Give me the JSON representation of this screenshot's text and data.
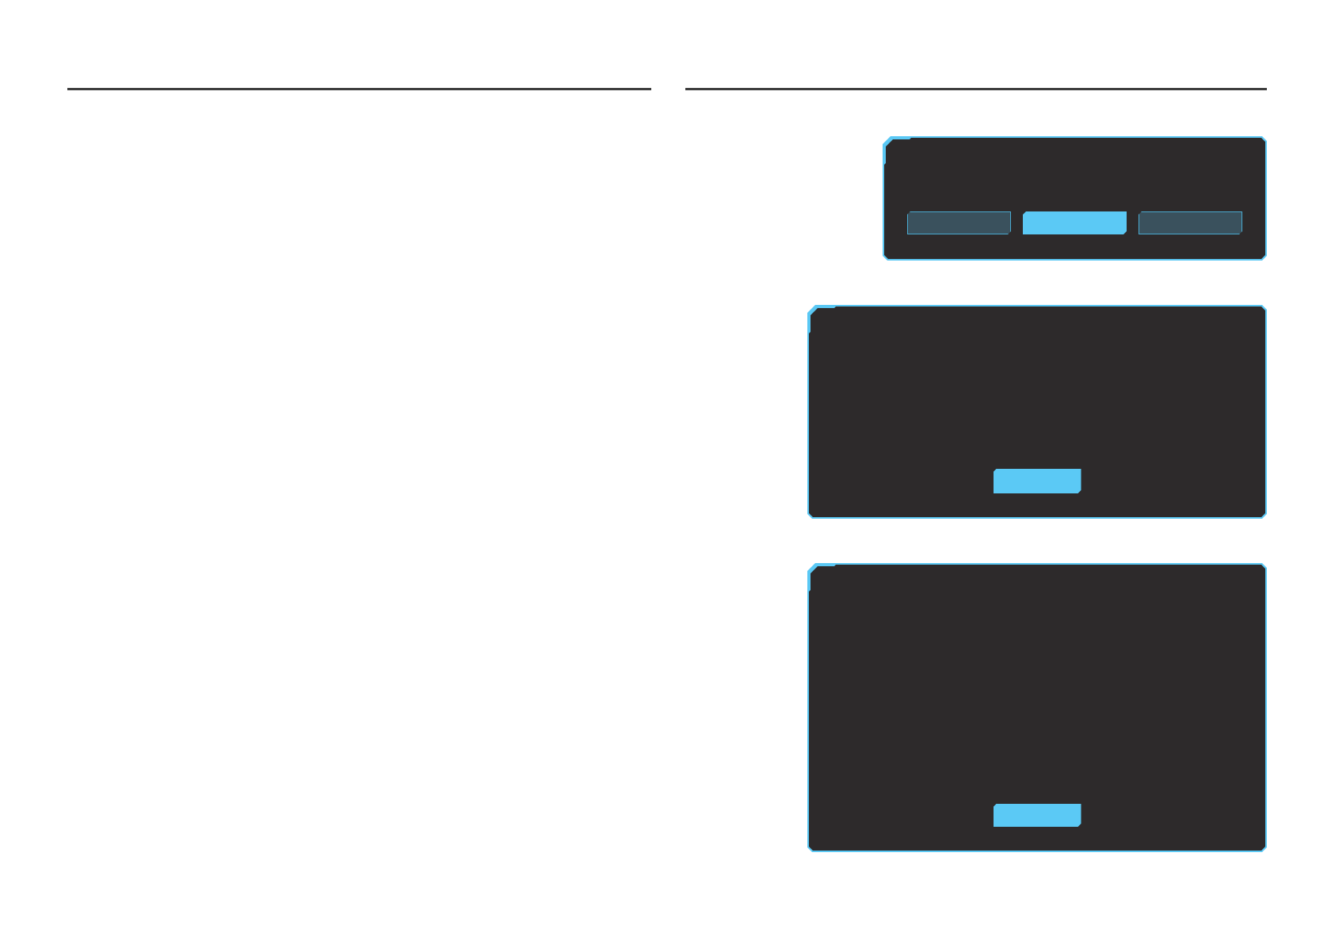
{
  "dialogs": [
    {
      "buttons": [
        {
          "selected": false
        },
        {
          "selected": true
        },
        {
          "selected": false
        }
      ]
    },
    {
      "buttons": [
        {
          "selected": true
        }
      ]
    },
    {
      "buttons": [
        {
          "selected": true
        }
      ]
    }
  ]
}
